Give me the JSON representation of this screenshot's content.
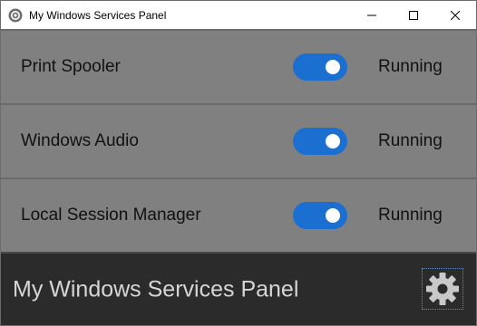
{
  "window": {
    "title": "My Windows Services Panel"
  },
  "services": [
    {
      "name": "Print Spooler",
      "enabled": true,
      "status": "Running"
    },
    {
      "name": "Windows Audio",
      "enabled": true,
      "status": "Running"
    },
    {
      "name": "Local Session Manager",
      "enabled": true,
      "status": "Running"
    }
  ],
  "footer": {
    "title": "My Windows Services Panel",
    "settings_icon": "gear-icon"
  },
  "colors": {
    "toggle_on": "#1a6fd1",
    "panel_bg": "#808080",
    "footer_bg": "#2b2b2b"
  }
}
